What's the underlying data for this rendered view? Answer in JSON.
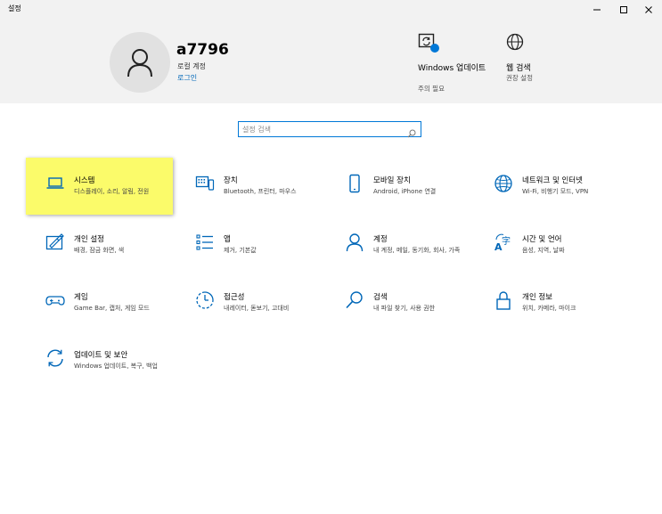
{
  "window": {
    "title": "설정",
    "minimize_symbol": "—",
    "maximize_symbol": "□",
    "close_symbol": "✕"
  },
  "account": {
    "username": "a7796",
    "account_type": "로컬 계정",
    "login_link": "로그인",
    "avatar_icon": "person-icon"
  },
  "header_items": [
    {
      "title": "Windows 업데이트",
      "subtitle": "주의 필요",
      "icon": "windows-update-icon",
      "badge_color": "#0078d7"
    },
    {
      "title": "웹 검색",
      "subtitle": "권장 설정",
      "icon": "globe-icon"
    }
  ],
  "search": {
    "placeholder": "설정 검색",
    "value": "",
    "icon": "search-icon"
  },
  "accent_color": "#0078d7",
  "highlight_color": "#fbfb6a",
  "categories": [
    {
      "name": "시스템",
      "desc": "디스플레이, 소리, 알림, 전원",
      "icon": "laptop-icon",
      "highlighted": true
    },
    {
      "name": "장치",
      "desc": "Bluetooth, 프린터, 마우스",
      "icon": "keyboard-device-icon"
    },
    {
      "name": "모바일 장치",
      "desc": "Android, iPhone 연결",
      "icon": "phone-icon"
    },
    {
      "name": "네트워크 및 인터넷",
      "desc": "Wi-Fi, 비행기 모드, VPN",
      "icon": "globe-icon"
    },
    {
      "name": "개인 설정",
      "desc": "배경, 잠금 화면, 색",
      "icon": "paint-icon"
    },
    {
      "name": "앱",
      "desc": "제거, 기본값",
      "icon": "apps-list-icon"
    },
    {
      "name": "계정",
      "desc": "내 계정, 메일, 동기화, 회사, 가족",
      "icon": "person-icon"
    },
    {
      "name": "시간 및 언어",
      "desc": "음성, 지역, 날짜",
      "icon": "language-icon"
    },
    {
      "name": "게임",
      "desc": "Game Bar, 캡처, 게임 모드",
      "icon": "gamepad-icon"
    },
    {
      "name": "접근성",
      "desc": "내레이터, 돋보기, 고대비",
      "icon": "ease-of-access-icon"
    },
    {
      "name": "검색",
      "desc": "내 파일 찾기, 사용 권한",
      "icon": "search-icon"
    },
    {
      "name": "개인 정보",
      "desc": "위치, 카메라, 마이크",
      "icon": "lock-icon"
    },
    {
      "name": "업데이트 및 보안",
      "desc": "Windows 업데이트, 복구, 백업",
      "icon": "sync-icon"
    }
  ]
}
